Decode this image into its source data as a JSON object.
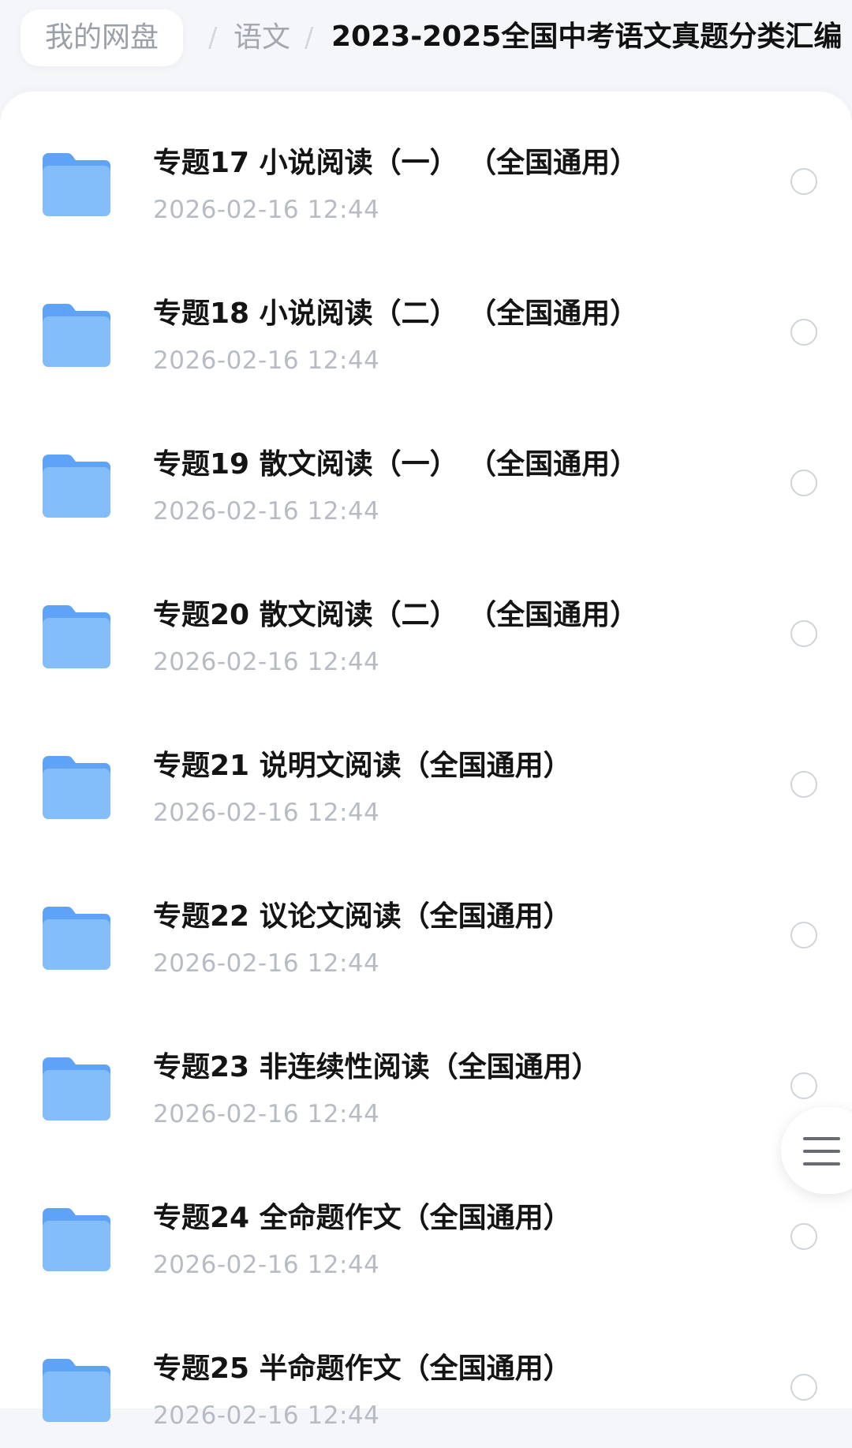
{
  "breadcrumb": {
    "root": "我的网盘",
    "separator": "/",
    "parent": "语文",
    "current": "2023-2025全国中考语文真题分类汇编"
  },
  "files": [
    {
      "name": "专题17 小说阅读（一） （全国通用）",
      "date": "2026-02-16 12:44"
    },
    {
      "name": "专题18 小说阅读（二） （全国通用）",
      "date": "2026-02-16 12:44"
    },
    {
      "name": "专题19 散文阅读（一） （全国通用）",
      "date": "2026-02-16 12:44"
    },
    {
      "name": "专题20 散文阅读（二） （全国通用）",
      "date": "2026-02-16 12:44"
    },
    {
      "name": "专题21 说明文阅读（全国通用）",
      "date": "2026-02-16 12:44"
    },
    {
      "name": "专题22 议论文阅读（全国通用）",
      "date": "2026-02-16 12:44"
    },
    {
      "name": "专题23 非连续性阅读（全国通用）",
      "date": "2026-02-16 12:44"
    },
    {
      "name": "专题24 全命题作文（全国通用）",
      "date": "2026-02-16 12:44"
    },
    {
      "name": "专题25 半命题作文（全国通用）",
      "date": "2026-02-16 12:44"
    }
  ],
  "icons": {
    "folder": "folder-icon",
    "select": "radio-circle-icon",
    "menu": "hamburger-menu-icon"
  },
  "colors": {
    "folder": "#5ea3f7",
    "title": "#141414",
    "date": "#b7bcc4"
  }
}
